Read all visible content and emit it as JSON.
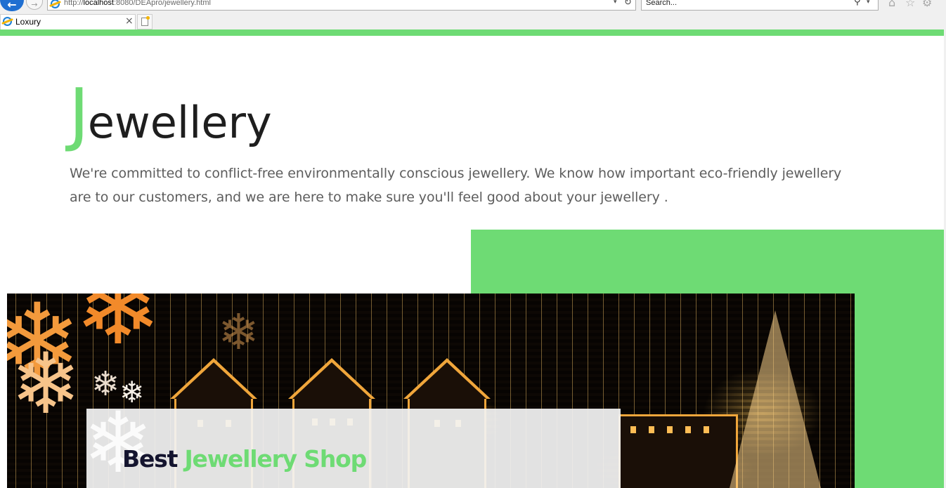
{
  "browser": {
    "url_prefix": "http://",
    "url_host": "localhost",
    "url_rest": ":8080/DEApro/jewellery.html",
    "search_placeholder": "Search...",
    "tab_title": "Loxury",
    "tab_close": "×",
    "back_icon": "←",
    "forward_icon": "→",
    "refresh_icon": "↻",
    "dropdown_icon": "▾",
    "search_icon": "⚲",
    "home_icon": "⌂",
    "favorites_icon": "☆",
    "settings_icon": "⚙"
  },
  "colors": {
    "accent": "#6edb74",
    "heading": "#1e1e1e",
    "body_text": "#5d5d5d",
    "banner_dark": "#14142e"
  },
  "section": {
    "heading_initial": "J",
    "heading_rest": "ewellery",
    "intro": "We're committed to conflict-free environmentally conscious jewellery. We know how important eco-friendly jewellery are to our customers, and we are here to make sure you'll feel good about your jewellery ."
  },
  "banner": {
    "title_dark": "Best",
    "title_green": "Jewellery Shop"
  }
}
